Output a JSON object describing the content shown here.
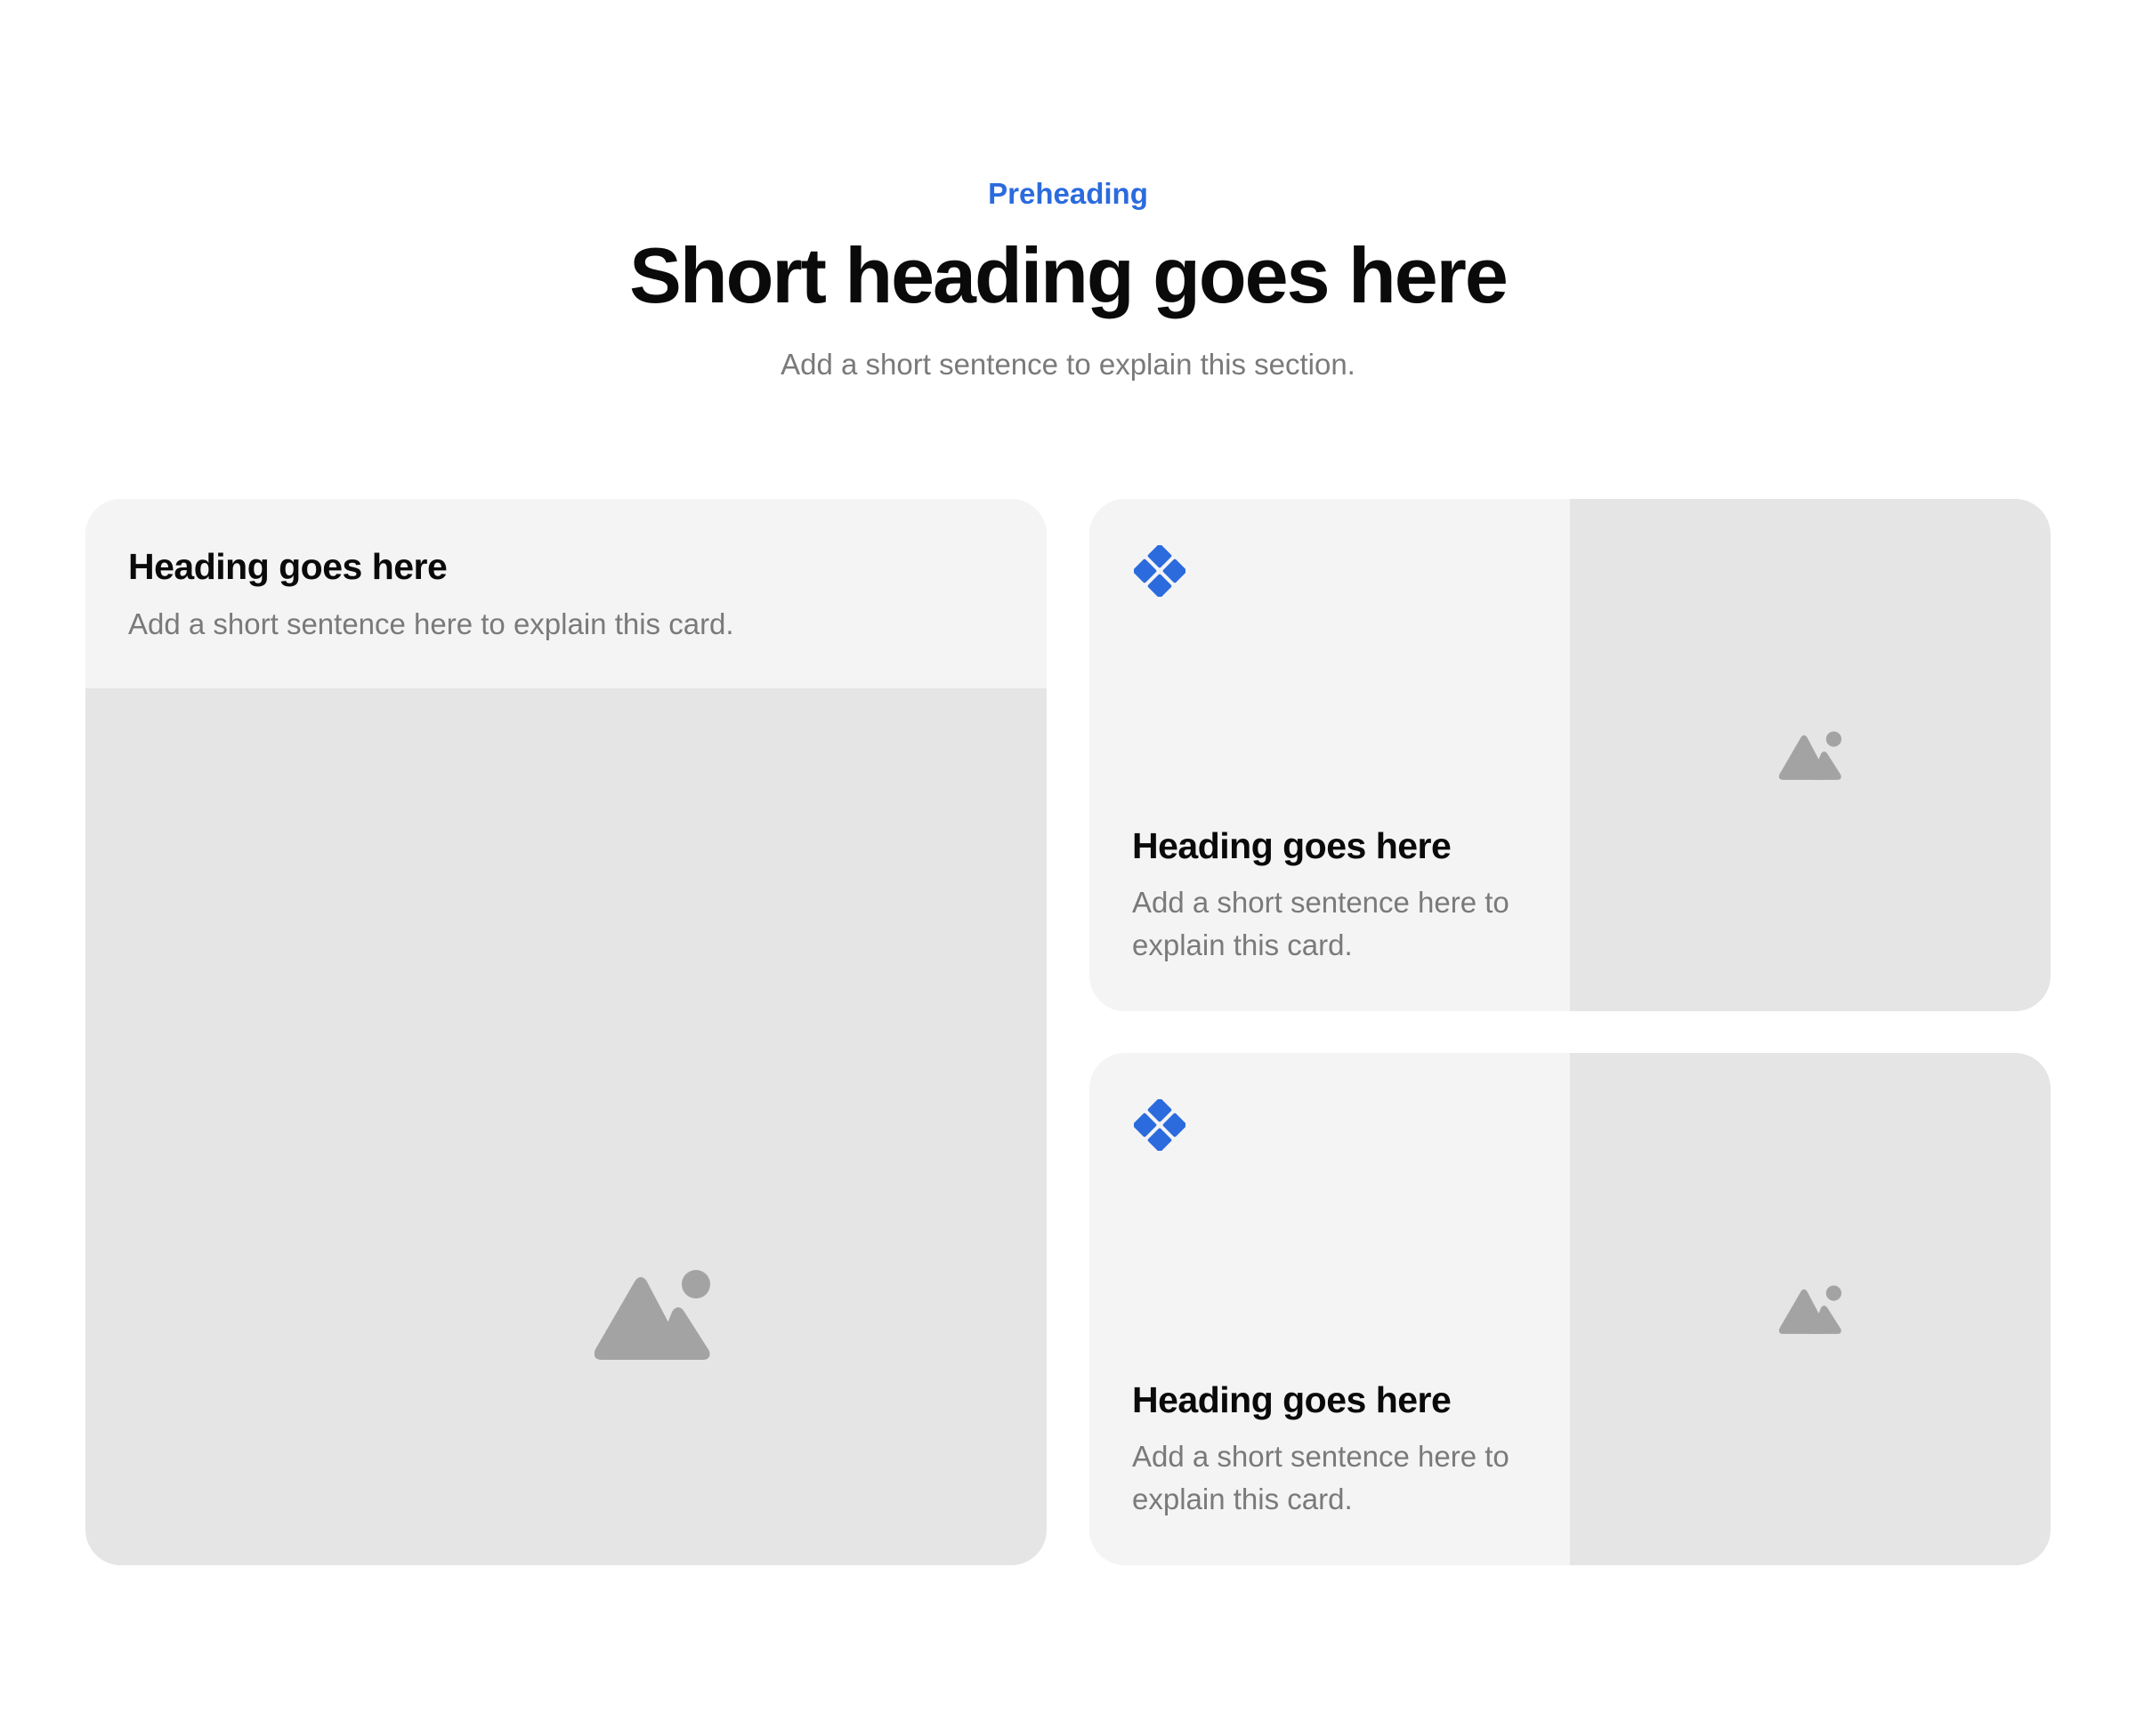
{
  "section": {
    "preheading": "Preheading",
    "heading": "Short heading goes here",
    "subheading": "Add a short sentence to explain this section."
  },
  "cards": [
    {
      "heading": "Heading goes here",
      "description": "Add a short sentence here to explain this card.",
      "image_icon": "image-placeholder-icon"
    },
    {
      "feature_icon": "component-diamond-icon",
      "heading": "Heading goes here",
      "description": "Add a short sentence here to explain this card.",
      "image_icon": "image-placeholder-icon"
    },
    {
      "feature_icon": "component-diamond-icon",
      "heading": "Heading goes here",
      "description": "Add a short sentence here to explain this card.",
      "image_icon": "image-placeholder-icon"
    }
  ],
  "colors": {
    "accent": "#2b6bdd",
    "heading": "#0a0a0a",
    "muted_text": "#7a7a7a",
    "card_bg": "#f4f4f4",
    "media_bg": "#e5e5e5",
    "placeholder_icon": "#a3a3a3"
  }
}
